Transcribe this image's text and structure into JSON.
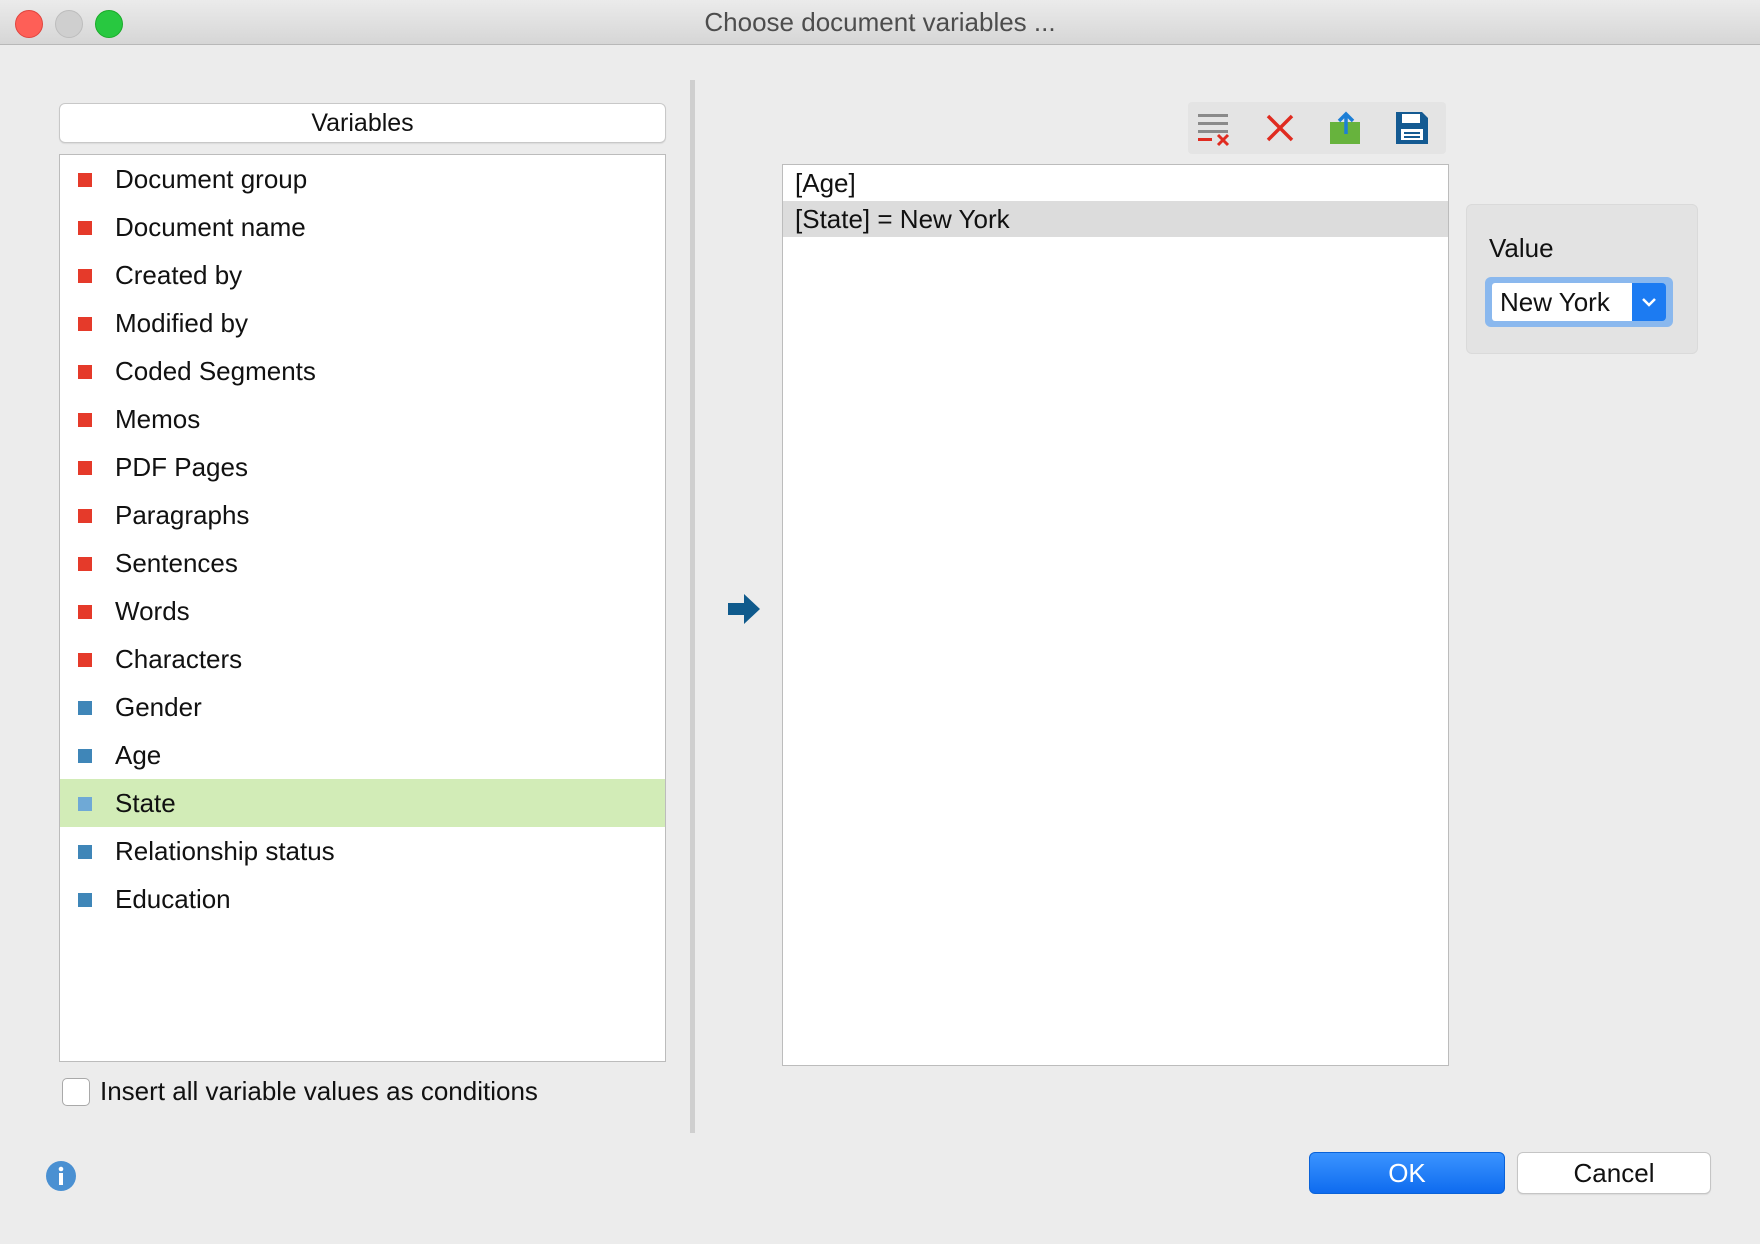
{
  "window": {
    "title": "Choose document variables ..."
  },
  "variables": {
    "header": "Variables",
    "items": [
      {
        "label": "Document group",
        "color": "#e53a2a"
      },
      {
        "label": "Document name",
        "color": "#e53a2a"
      },
      {
        "label": "Created by",
        "color": "#e53a2a"
      },
      {
        "label": "Modified by",
        "color": "#e53a2a"
      },
      {
        "label": "Coded Segments",
        "color": "#e53a2a"
      },
      {
        "label": "Memos",
        "color": "#e53a2a"
      },
      {
        "label": "PDF Pages",
        "color": "#e53a2a"
      },
      {
        "label": "Paragraphs",
        "color": "#e53a2a"
      },
      {
        "label": "Sentences",
        "color": "#e53a2a"
      },
      {
        "label": "Words",
        "color": "#e53a2a"
      },
      {
        "label": "Characters",
        "color": "#e53a2a"
      },
      {
        "label": "Gender",
        "color": "#3f86b8"
      },
      {
        "label": "Age",
        "color": "#3f86b8"
      },
      {
        "label": "State",
        "color": "#6fa9d6",
        "selected": true
      },
      {
        "label": "Relationship status",
        "color": "#3f86b8"
      },
      {
        "label": "Education",
        "color": "#3f86b8"
      }
    ],
    "insert_all_label": "Insert all variable values as conditions",
    "insert_all_checked": false
  },
  "toolbar": {
    "icons": [
      "clear-list-icon",
      "delete-icon",
      "export-icon",
      "save-icon"
    ]
  },
  "conditions": {
    "items": [
      {
        "label": "[Age]"
      },
      {
        "label": "[State] = New York",
        "selected": true
      }
    ]
  },
  "value_panel": {
    "label": "Value",
    "selected_value": "New York"
  },
  "buttons": {
    "ok": "OK",
    "cancel": "Cancel"
  },
  "colors": {
    "accent": "#1c7bf2",
    "selected_row": "#d2ecb7",
    "arrow": "#0f5a8c"
  }
}
